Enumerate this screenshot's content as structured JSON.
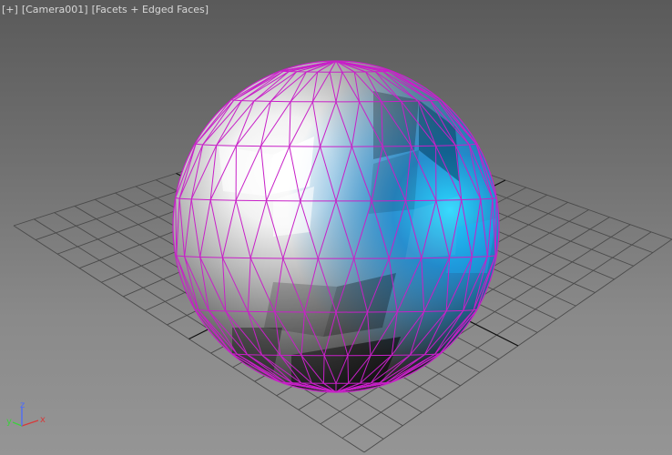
{
  "viewport": {
    "menu_label": "[+]",
    "camera_label": "[Camera001]",
    "shading_label": "[Facets + Edged Faces]"
  },
  "axis_gizmo": {
    "x_label": "x",
    "y_label": "y",
    "z_label": "z",
    "x_color": "#d63b3b",
    "y_color": "#3ecf3e",
    "z_color": "#4a6bff"
  },
  "colors": {
    "grid_line": "#4a4a4a",
    "grid_axis": "#111111",
    "edge_wire": "#c820c8",
    "sphere_light": "#ffffff",
    "sphere_mid": "#8c8c8c",
    "sphere_dark": "#1c1c1c",
    "sphere_blue": "#1fa8f0"
  }
}
